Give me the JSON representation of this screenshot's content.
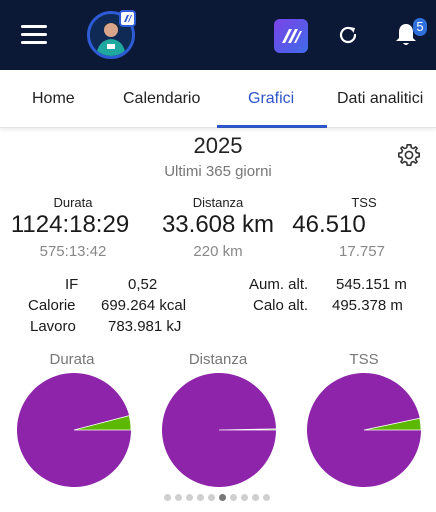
{
  "header": {
    "menu_icon": "hamburger-menu-icon",
    "logo_icon": "xert-logo-icon",
    "refresh_icon": "refresh-icon",
    "bell_icon": "bell-icon",
    "notification_count": "5"
  },
  "tabs": [
    {
      "label": "Home",
      "active": false
    },
    {
      "label": "Calendario",
      "active": false
    },
    {
      "label": "Grafici",
      "active": true
    },
    {
      "label": "Dati analitici",
      "active": false
    }
  ],
  "summary": {
    "year": "2025",
    "period": "Ultimi 365 giorni",
    "settings_icon": "gear-icon"
  },
  "stats": [
    {
      "label": "Durata",
      "value": "1124:18:29",
      "sub": "575:13:42"
    },
    {
      "label": "Distanza",
      "value": "33.608 km",
      "sub": "220 km"
    },
    {
      "label": "TSS",
      "value": "46.510",
      "sub": "17.757"
    }
  ],
  "metrics_left": [
    {
      "label": "IF",
      "value": "0,52"
    },
    {
      "label": "Calorie",
      "value": "699.264 kcal"
    },
    {
      "label": "Lavoro",
      "value": "783.981 kJ"
    }
  ],
  "metrics_right": [
    {
      "label": "Aum. alt.",
      "value": "545.151 m"
    },
    {
      "label": "Calo alt.",
      "value": "495.378 m"
    }
  ],
  "chart_data": [
    {
      "type": "pie",
      "title": "Durata",
      "slices": [
        {
          "value": 1124.31
        },
        {
          "value": 575.23
        }
      ],
      "colors": [
        "#8e24aa",
        "#5cb800"
      ]
    },
    {
      "type": "pie",
      "title": "Distanza",
      "slices": [
        {
          "value": 33608
        },
        {
          "value": 220
        }
      ],
      "colors": [
        "#8e24aa",
        "#5cb800"
      ]
    },
    {
      "type": "pie",
      "title": "TSS",
      "slices": [
        {
          "value": 46510
        },
        {
          "value": 17757
        }
      ],
      "colors": [
        "#8e24aa",
        "#5cb800"
      ]
    }
  ],
  "pager": {
    "count": 10,
    "active_index": 5
  }
}
